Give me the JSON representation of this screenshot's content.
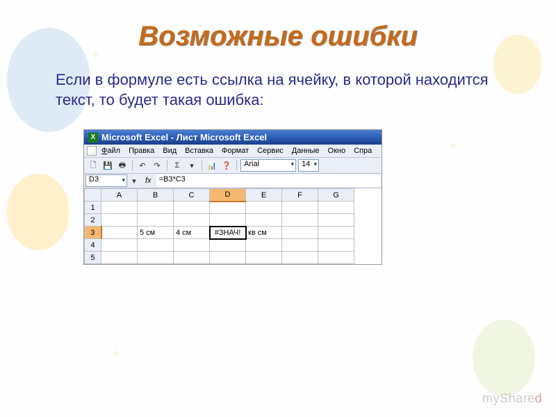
{
  "slide": {
    "title": "Возможные ошибки",
    "description": "Если в формуле есть ссылка на ячейку, в которой находится текст, то будет такая ошибка:"
  },
  "excel": {
    "title": "Microsoft Excel - Лист Microsoft Excel",
    "menu": {
      "file": "Файл",
      "edit": "Правка",
      "view": "Вид",
      "insert": "Вставка",
      "format": "Формат",
      "tools": "Сервис",
      "data": "Данные",
      "window": "Окно",
      "help": "Спра"
    },
    "toolbar": {
      "font_name": "Arial",
      "font_size": "14",
      "sigma": "Σ",
      "fx": "fx"
    },
    "name_box": "D3",
    "formula": "=B3*C3",
    "columns": [
      "A",
      "B",
      "C",
      "D",
      "E",
      "F",
      "G"
    ],
    "active_col": "D",
    "active_row": "3",
    "rows": [
      {
        "n": "1",
        "cells": [
          "",
          "",
          "",
          "",
          "",
          "",
          ""
        ]
      },
      {
        "n": "2",
        "cells": [
          "",
          "",
          "",
          "",
          "",
          "",
          ""
        ]
      },
      {
        "n": "3",
        "cells": [
          "",
          "5 см",
          "4 см",
          "#ЗНАЧ!",
          "кв см",
          "",
          ""
        ]
      },
      {
        "n": "4",
        "cells": [
          "",
          "",
          "",
          "",
          "",
          "",
          ""
        ]
      },
      {
        "n": "5",
        "cells": [
          "",
          "",
          "",
          "",
          "",
          "",
          ""
        ]
      }
    ]
  },
  "watermark": {
    "text1": "myShare",
    "text2": "d"
  }
}
